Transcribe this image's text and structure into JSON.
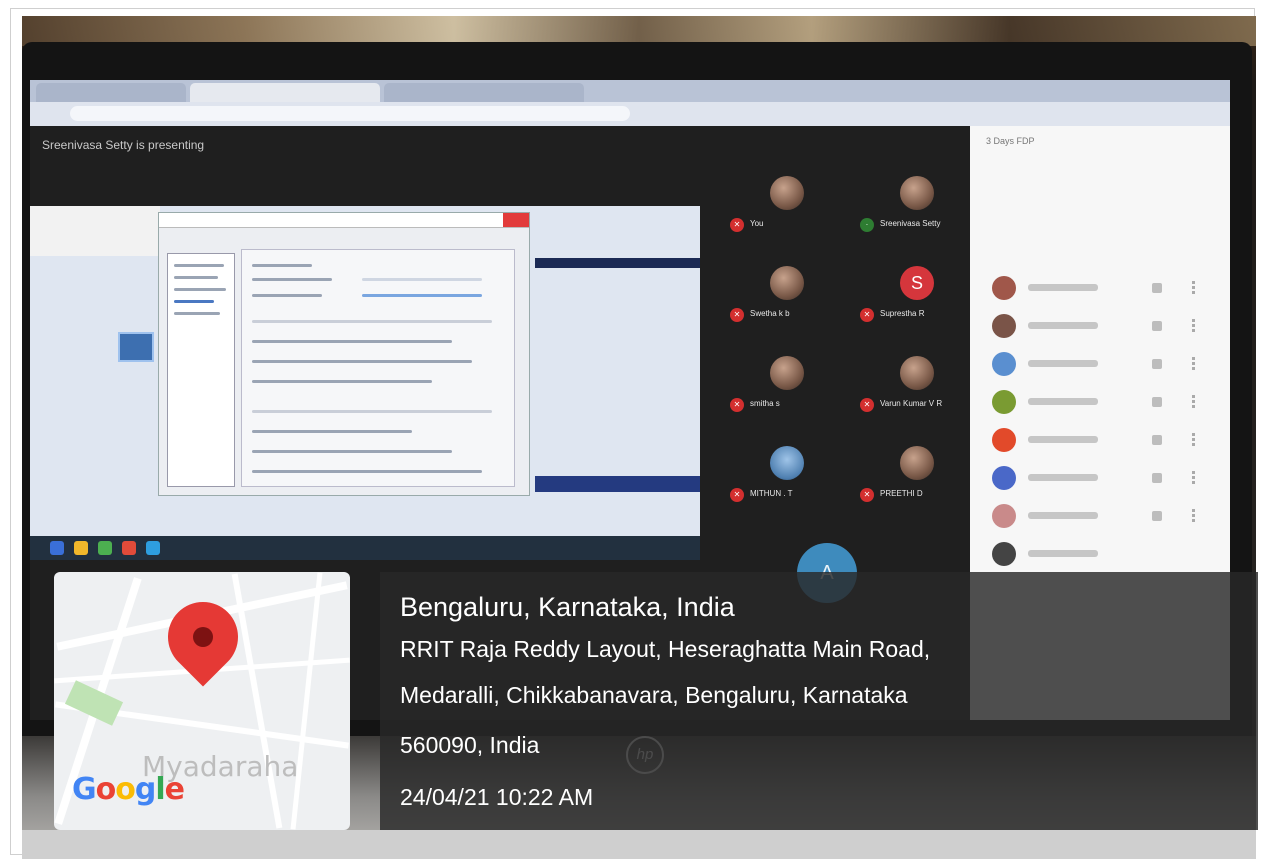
{
  "screen": {
    "presenting": "Sreenivasa Setty is presenting",
    "sidebar_header": "3 Days FDP",
    "participants": [
      {
        "name": "You",
        "tile": "face"
      },
      {
        "name": "Sreenivasa Setty",
        "tile": "face"
      },
      {
        "name": "Swetha k b",
        "tile": "face"
      },
      {
        "name": "Suprestha R",
        "tile": "letter",
        "letter": "S"
      },
      {
        "name": "smitha s",
        "tile": "face"
      },
      {
        "name": "Varun Kumar V R",
        "tile": "face"
      },
      {
        "name": "MITHUN . T",
        "tile": "face"
      },
      {
        "name": "PREETHI D",
        "tile": "face"
      }
    ],
    "extra_avatar": "A"
  },
  "map": {
    "label": "Myadaraha",
    "logo": "Google",
    "pin_color": "#e53935"
  },
  "location": {
    "city_line": "Bengaluru, Karnataka, India",
    "address_line1": "RRIT Raja Reddy Layout, Heseraghatta Main Road,",
    "address_line2": "Medaralli, Chikkabanavara, Bengaluru, Karnataka",
    "address_line3": "560090, India",
    "timestamp": "24/04/21 10:22 AM"
  },
  "device": {
    "brand_logo": "hp"
  }
}
